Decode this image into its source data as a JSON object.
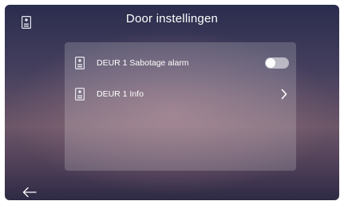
{
  "header": {
    "title": "Door instellingen",
    "icon": "door-panel-icon"
  },
  "settings": [
    {
      "label": "DEUR 1 Sabotage alarm",
      "icon": "door-panel-icon",
      "control": "toggle",
      "toggle_on": false
    },
    {
      "label": "DEUR 1 Info",
      "icon": "door-panel-icon",
      "control": "chevron-right-icon"
    }
  ],
  "footer": {
    "back_icon": "back-arrow-icon"
  },
  "colors": {
    "text": "#ffffff",
    "panel": "rgba(255,255,255,0.18)"
  }
}
